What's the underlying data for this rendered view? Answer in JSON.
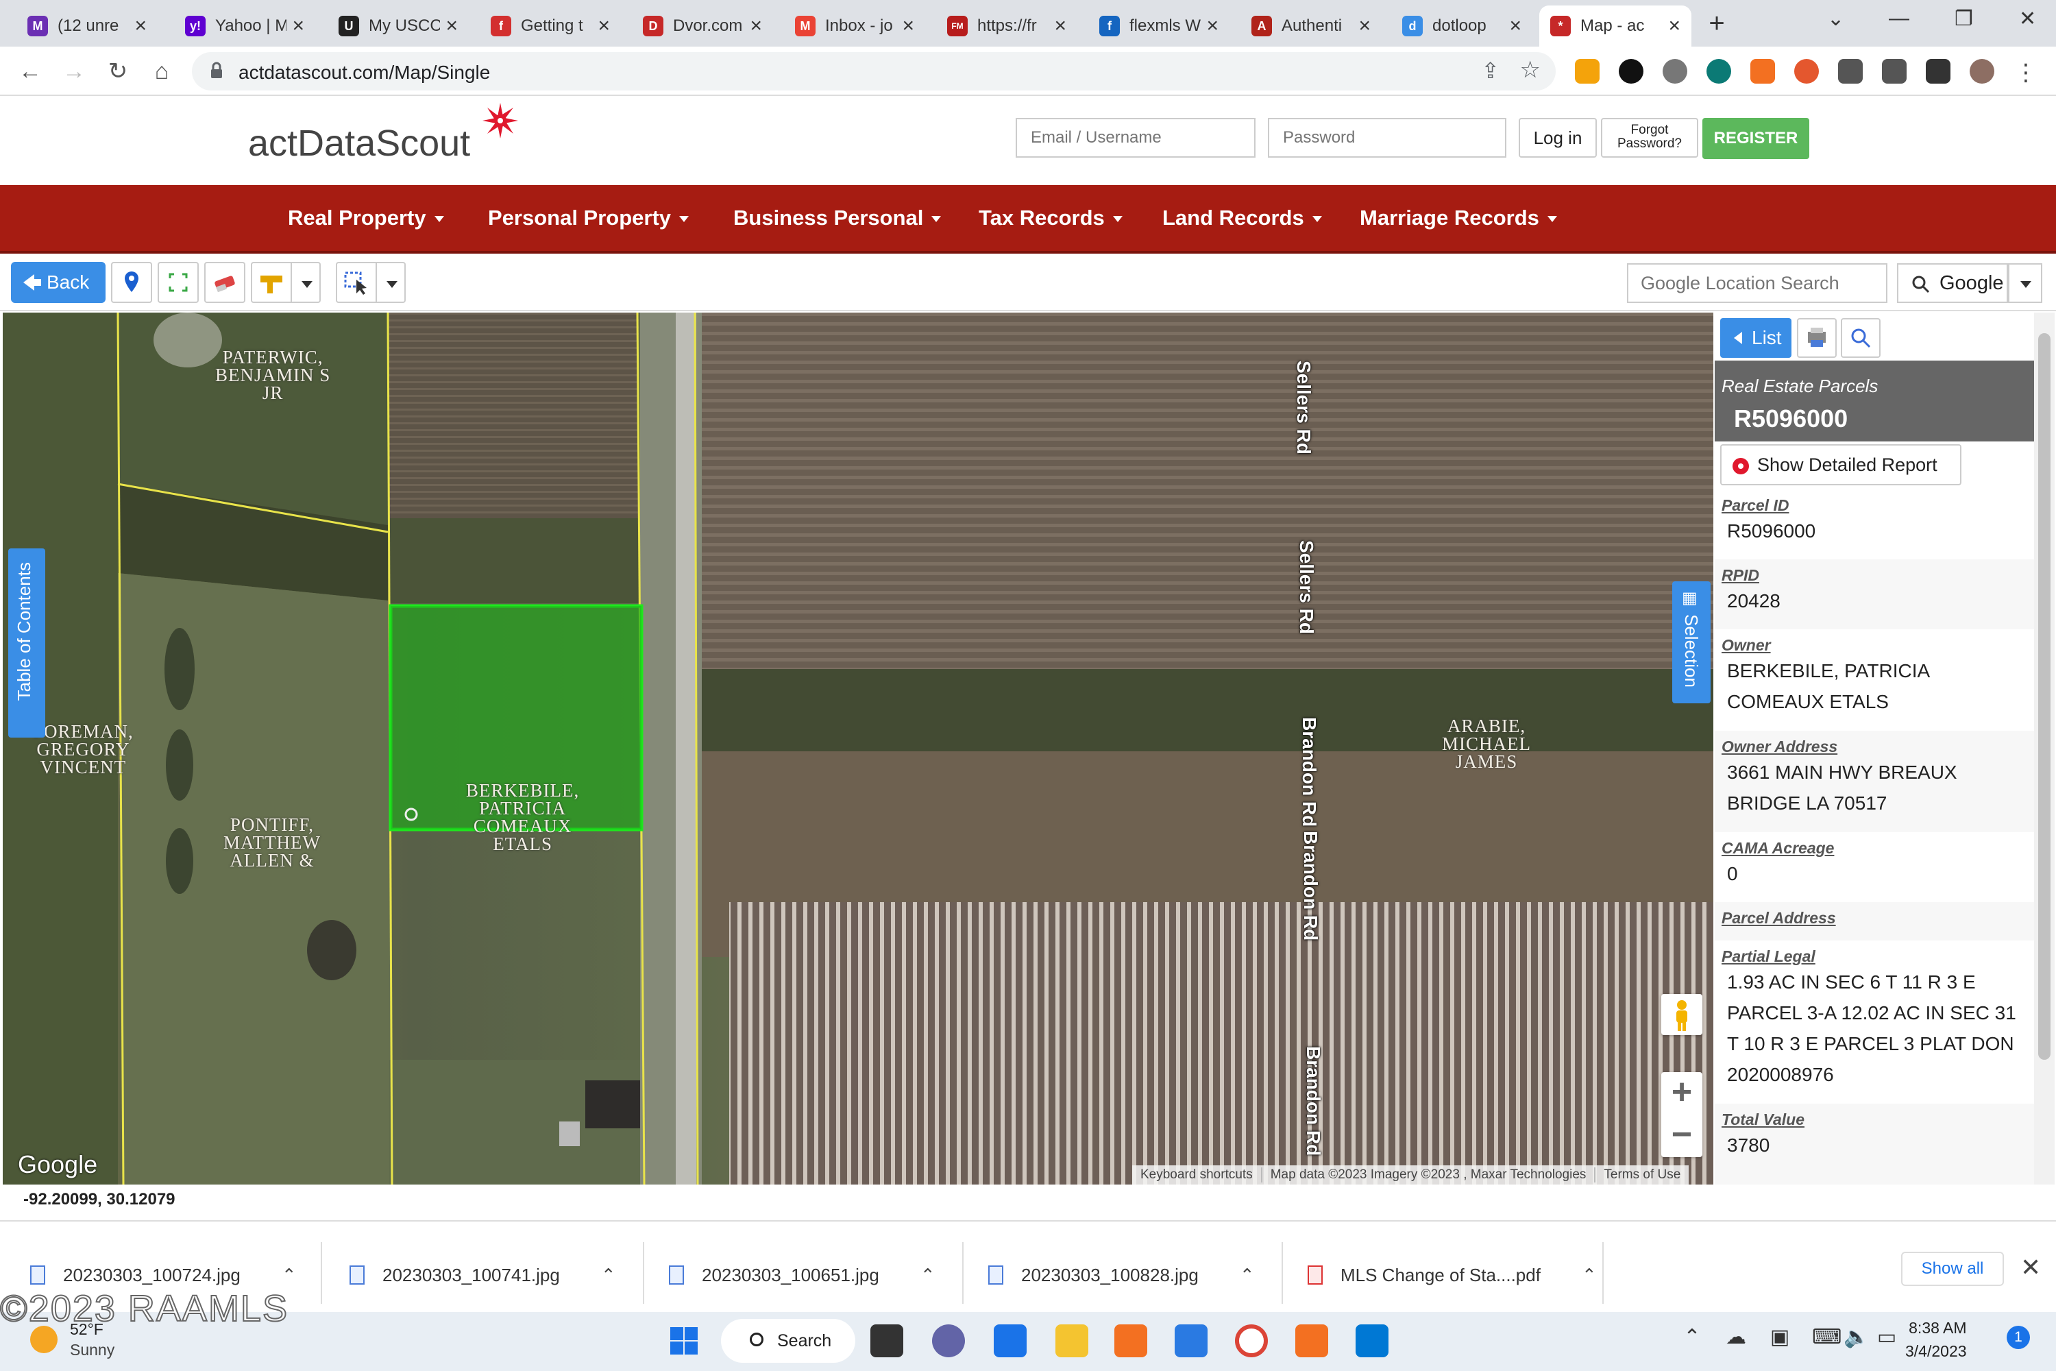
{
  "browser": {
    "tabs": [
      {
        "title": "(12 unre",
        "color": "#6b2fb3",
        "glyph": "M"
      },
      {
        "title": "Yahoo | M",
        "color": "#5f01d1",
        "glyph": "y!"
      },
      {
        "title": "My USCC",
        "color": "#222222",
        "glyph": "U"
      },
      {
        "title": "Getting t",
        "color": "#d32f2f",
        "glyph": "f"
      },
      {
        "title": "Dvor.com",
        "color": "#c62828",
        "glyph": "D"
      },
      {
        "title": "Inbox - jo",
        "color": "#ea4335",
        "glyph": "M"
      },
      {
        "title": "https://fr",
        "color": "#b71c1c",
        "glyph": "FM"
      },
      {
        "title": "flexmls W",
        "color": "#1565c0",
        "glyph": "f"
      },
      {
        "title": "Authenti",
        "color": "#b0231a",
        "glyph": "A"
      },
      {
        "title": "dotloop",
        "color": "#3a8ee6",
        "glyph": "d"
      },
      {
        "title": "Map - ac",
        "color": "#c62828",
        "glyph": "*"
      }
    ],
    "new_tab": "+",
    "url": "actdatascout.com/Map/Single"
  },
  "site": {
    "logo": "actDataScout",
    "login": {
      "username_placeholder": "Email / Username",
      "password_placeholder": "Password",
      "login_label": "Log in",
      "forgot_label_1": "Forgot",
      "forgot_label_2": "Password?",
      "register_label": "REGISTER"
    },
    "menu": [
      "Real Property",
      "Personal Property",
      "Business Personal",
      "Tax Records",
      "Land Records",
      "Marriage Records"
    ],
    "colors": {
      "menu_bg": "#a61c12",
      "accent": "#3a8ee6",
      "register": "#5cb85c",
      "parcel": "#1ee81e"
    }
  },
  "toolbar": {
    "back_label": "Back",
    "search_placeholder": "Google Location Search",
    "provider_label": "Google"
  },
  "map": {
    "owner_labels": {
      "paterwic": "PATERWIC,\nBENJAMIN S\nJR",
      "foreman": "FOREMAN,\nGREGORY\nVINCENT",
      "pontiff": "PONTIFF,\nMATTHEW\nALLEN &",
      "berkebile": "BERKEBILE,\nPATRICIA\nCOMEAUX\nETALS",
      "arabie": "ARABIE,\nMICHAEL\nJAMES"
    },
    "roads": {
      "sellers_1": "Sellers Rd",
      "sellers_2": "Sellers Rd",
      "brandon_1": "Brandon Rd",
      "brandon_2": "Brandon Rd",
      "brandon_3": "Brandon Rd"
    },
    "toc_label": "Table of Contents",
    "selection_label": "Selection",
    "provider_logo": "Google",
    "attribution": {
      "shortcuts": "Keyboard shortcuts",
      "data": "Map data ©2023 Imagery ©2023 , Maxar Technologies",
      "terms": "Terms of Use"
    },
    "coordinates": "-92.20099, 30.12079"
  },
  "panel": {
    "list_label": "List",
    "layer_title": "Real Estate Parcels",
    "parcel_id_header": "R5096000",
    "report_label": "Show Detailed Report",
    "fields": [
      {
        "label": "Parcel ID",
        "value": "R5096000"
      },
      {
        "label": "RPID",
        "value": "20428"
      },
      {
        "label": "Owner",
        "value": "BERKEBILE, PATRICIA\nCOMEAUX ETALS"
      },
      {
        "label": "Owner Address",
        "value": "3661 MAIN HWY BREAUX\nBRIDGE LA 70517"
      },
      {
        "label": "CAMA Acreage",
        "value": "0"
      },
      {
        "label": "Parcel Address",
        "value": ""
      },
      {
        "label": "Partial Legal",
        "value": "1.93 AC IN SEC 6 T 11 R 3 E\nPARCEL 3-A 12.02 AC IN SEC 31\nT 10 R 3 E PARCEL 3 PLAT DON\n2020008976"
      },
      {
        "label": "Total Value",
        "value": "3780"
      }
    ]
  },
  "downloads": {
    "items": [
      "20230303_100724.jpg",
      "20230303_100741.jpg",
      "20230303_100651.jpg",
      "20230303_100828.jpg",
      "MLS Change of Sta....pdf"
    ],
    "show_all": "Show all"
  },
  "taskbar": {
    "weather_temp": "52°F",
    "weather_desc": "Sunny",
    "search_label": "Search",
    "time": "8:38 AM",
    "date": "3/4/2023",
    "notifications": "1"
  },
  "watermark": "©2023 RAAMLS"
}
